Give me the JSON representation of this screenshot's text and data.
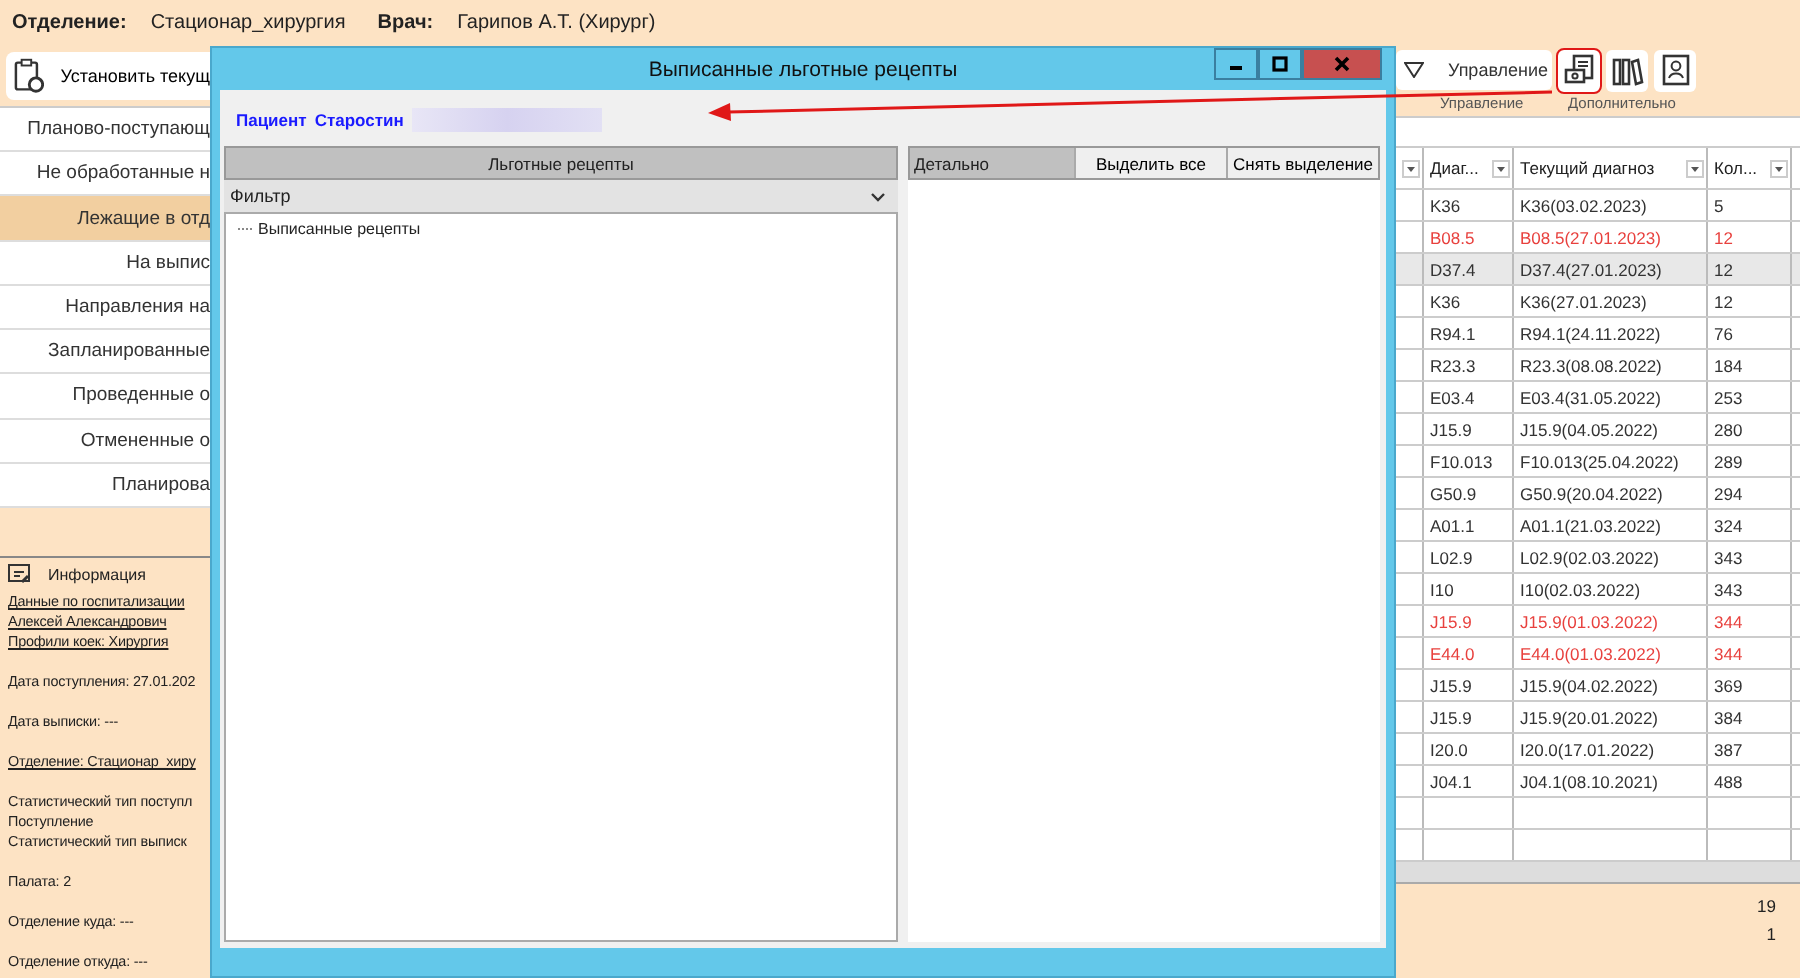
{
  "header": {
    "department_label": "Отделение:",
    "department": "Стационар_хирургия",
    "doctor_label": "Врач:",
    "doctor": "Гарипов А.Т. (Хирург)"
  },
  "toolbar": {
    "set_current_button": "Установить текущ",
    "manage_button": "Управление",
    "groups": [
      {
        "label": "Управление"
      },
      {
        "label": "Дополнительно"
      }
    ]
  },
  "nav": [
    {
      "label": "Планово-поступающ",
      "selected": false
    },
    {
      "label": "Не обработанные н",
      "selected": false
    },
    {
      "label": "Лежащие в отд",
      "selected": true
    },
    {
      "label": "На выпис",
      "selected": false
    },
    {
      "label": "Направления на",
      "selected": false
    },
    {
      "label": "Запланированные",
      "selected": false
    },
    {
      "label": "Проведенные о",
      "selected": false
    },
    {
      "label": "Отмененные о",
      "selected": false
    },
    {
      "label": "Планирова",
      "selected": false
    }
  ],
  "info": {
    "title": "Информация",
    "blocks": [
      {
        "lines": [
          {
            "text": "Данные по госпитализации",
            "kind": "link"
          },
          {
            "text": "Алексей Александрович",
            "kind": "link"
          },
          {
            "text": "Профили коек: Хирургия",
            "kind": "link"
          }
        ]
      },
      {
        "lines": [
          {
            "text": "Дата поступления: 27.01.202",
            "kind": "text"
          }
        ]
      },
      {
        "lines": [
          {
            "text": "Дата выписки: ---",
            "kind": "text"
          }
        ]
      },
      {
        "lines": [
          {
            "text": "Отделение: Стационар_хиру",
            "kind": "link"
          }
        ]
      },
      {
        "lines": [
          {
            "text": "Статистический тип поступл",
            "kind": "text"
          },
          {
            "text": "Поступление",
            "kind": "text"
          },
          {
            "text": "Статистический тип выписк",
            "kind": "text"
          }
        ]
      },
      {
        "lines": [
          {
            "text": "Палата: 2",
            "kind": "text"
          }
        ]
      },
      {
        "lines": [
          {
            "text": "Отделение куда: ---",
            "kind": "text"
          }
        ]
      },
      {
        "lines": [
          {
            "text": "Отделение откуда: ---",
            "kind": "text"
          }
        ]
      }
    ]
  },
  "table": {
    "columns": [
      "Диаг...",
      "Текущий диагноз",
      "Кол..."
    ],
    "rows": [
      {
        "cells": [
          "K36",
          "K36(03.02.2023)",
          "5"
        ],
        "color": "#333333",
        "selected": false
      },
      {
        "cells": [
          "B08.5",
          "B08.5(27.01.2023)",
          "12"
        ],
        "color": "#e8413e",
        "selected": false
      },
      {
        "cells": [
          "D37.4",
          "D37.4(27.01.2023)",
          "12"
        ],
        "color": "#333333",
        "selected": true
      },
      {
        "cells": [
          "K36",
          "K36(27.01.2023)",
          "12"
        ],
        "color": "#333333",
        "selected": false
      },
      {
        "cells": [
          "R94.1",
          "R94.1(24.11.2022)",
          "76"
        ],
        "color": "#333333",
        "selected": false
      },
      {
        "cells": [
          "R23.3",
          "R23.3(08.08.2022)",
          "184"
        ],
        "color": "#333333",
        "selected": false
      },
      {
        "cells": [
          "E03.4",
          "E03.4(31.05.2022)",
          "253"
        ],
        "color": "#333333",
        "selected": false
      },
      {
        "cells": [
          "J15.9",
          "J15.9(04.05.2022)",
          "280"
        ],
        "color": "#333333",
        "selected": false
      },
      {
        "cells": [
          "F10.013",
          "F10.013(25.04.2022)",
          "289"
        ],
        "color": "#333333",
        "selected": false
      },
      {
        "cells": [
          "G50.9",
          "G50.9(20.04.2022)",
          "294"
        ],
        "color": "#333333",
        "selected": false
      },
      {
        "cells": [
          "A01.1",
          "A01.1(21.03.2022)",
          "324"
        ],
        "color": "#333333",
        "selected": false
      },
      {
        "cells": [
          "L02.9",
          "L02.9(02.03.2022)",
          "343"
        ],
        "color": "#333333",
        "selected": false
      },
      {
        "cells": [
          "I10",
          "I10(02.03.2022)",
          "343"
        ],
        "color": "#333333",
        "selected": false
      },
      {
        "cells": [
          "J15.9",
          "J15.9(01.03.2022)",
          "344"
        ],
        "color": "#e8413e",
        "selected": false
      },
      {
        "cells": [
          "E44.0",
          "E44.0(01.03.2022)",
          "344"
        ],
        "color": "#e8413e",
        "selected": false
      },
      {
        "cells": [
          "J15.9",
          "J15.9(04.02.2022)",
          "369"
        ],
        "color": "#333333",
        "selected": false
      },
      {
        "cells": [
          "J15.9",
          "J15.9(20.01.2022)",
          "384"
        ],
        "color": "#333333",
        "selected": false
      },
      {
        "cells": [
          "I20.0",
          "I20.0(17.01.2022)",
          "387"
        ],
        "color": "#333333",
        "selected": false
      },
      {
        "cells": [
          "J04.1",
          "J04.1(08.10.2021)",
          "488"
        ],
        "color": "#333333",
        "selected": false
      }
    ],
    "footer_totals": [
      "19",
      "1"
    ]
  },
  "dialog": {
    "title": "Выписанные льготные рецепты",
    "patient_label": "Пациент",
    "patient_name": "Старостин",
    "left_header": "Льготные рецепты",
    "filter": "Фильтр",
    "tree": [
      {
        "label": "Выписанные рецепты"
      }
    ],
    "right_header": "Детально",
    "buttons": [
      "Выделить все",
      "Снять выделение"
    ]
  }
}
